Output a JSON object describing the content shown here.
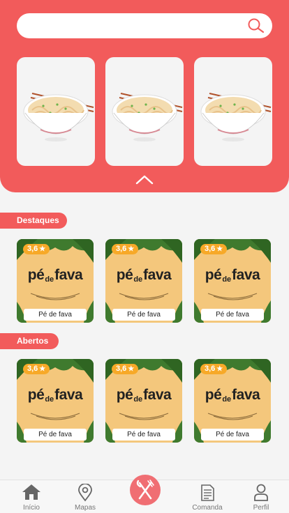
{
  "search": {
    "placeholder": "",
    "value": "",
    "icon": "search-icon"
  },
  "categories": [
    {
      "icon": "noodle-bowl-icon"
    },
    {
      "icon": "noodle-bowl-icon"
    },
    {
      "icon": "noodle-bowl-icon"
    }
  ],
  "sections": {
    "featured": {
      "title": "Destaques",
      "items": [
        {
          "rating": "3,6",
          "name": "Pé de fava",
          "logo_main_1": "pé",
          "logo_small": "de",
          "logo_main_2": "fava"
        },
        {
          "rating": "3,6",
          "name": "Pé de fava",
          "logo_main_1": "pé",
          "logo_small": "de",
          "logo_main_2": "fava"
        },
        {
          "rating": "3,6",
          "name": "Pé de fava",
          "logo_main_1": "pé",
          "logo_small": "de",
          "logo_main_2": "fava"
        }
      ]
    },
    "open": {
      "title": "Abertos",
      "items": [
        {
          "rating": "3,6",
          "name": "Pé de fava",
          "logo_main_1": "pé",
          "logo_small": "de",
          "logo_main_2": "fava"
        },
        {
          "rating": "3,6",
          "name": "Pé de fava",
          "logo_main_1": "pé",
          "logo_small": "de",
          "logo_main_2": "fava"
        },
        {
          "rating": "3,6",
          "name": "Pé de fava",
          "logo_main_1": "pé",
          "logo_small": "de",
          "logo_main_2": "fava"
        }
      ]
    }
  },
  "star": "★",
  "nav": {
    "home": "Início",
    "maps": "Mapas",
    "order": "Comanda",
    "profile": "Perfil"
  },
  "colors": {
    "brand": "#f25b5b",
    "rating": "#f7a928",
    "fab": "#f06e73"
  }
}
